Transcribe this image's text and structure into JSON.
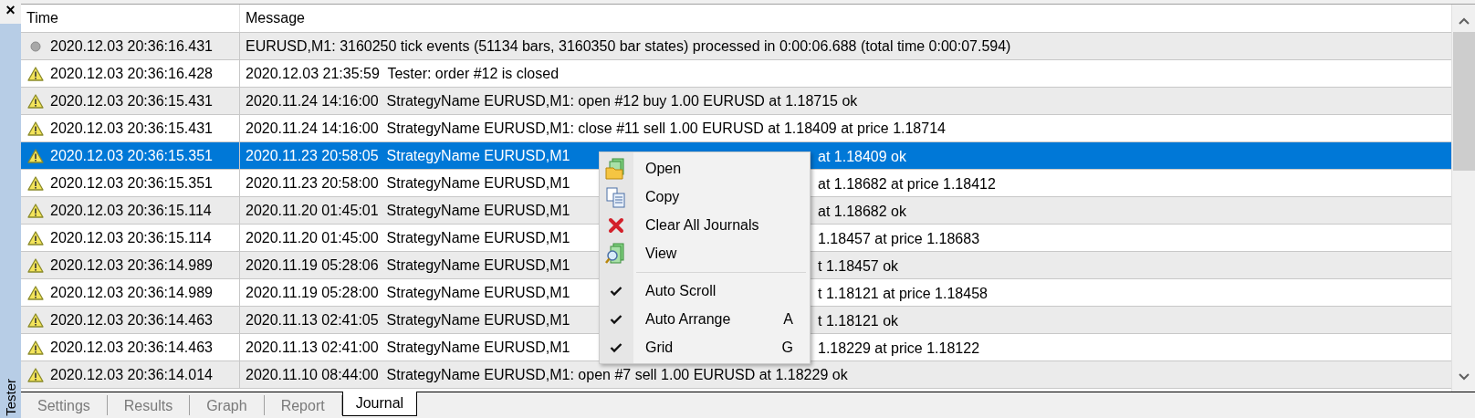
{
  "panel": {
    "close": "×",
    "title": "Tester"
  },
  "table": {
    "columns": [
      "Time",
      "Message"
    ],
    "rows": [
      {
        "kind": "info",
        "selected": false,
        "time": "2020.12.03 20:36:16.431",
        "message": "EURUSD,M1: 3160250 tick events (51134 bars, 3160350 bar states) processed in 0:00:06.688 (total time 0:00:07.594)"
      },
      {
        "kind": "warning",
        "selected": false,
        "time": "2020.12.03 20:36:16.428",
        "message": "2020.12.03 21:35:59  Tester: order #12 is closed"
      },
      {
        "kind": "warning",
        "selected": false,
        "time": "2020.12.03 20:36:15.431",
        "message": "2020.11.24 14:16:00  StrategyName EURUSD,M1: open #12 buy 1.00 EURUSD at 1.18715 ok"
      },
      {
        "kind": "warning",
        "selected": false,
        "time": "2020.12.03 20:36:15.431",
        "message": "2020.11.24 14:16:00  StrategyName EURUSD,M1: close #11 sell 1.00 EURUSD at 1.18409 at price 1.18714"
      },
      {
        "kind": "warning",
        "selected": true,
        "time": "2020.12.03 20:36:15.351",
        "message": "2020.11.23 20:58:05  StrategyName EURUSD,M1",
        "message_end": "at 1.18409 ok"
      },
      {
        "kind": "warning",
        "selected": false,
        "time": "2020.12.03 20:36:15.351",
        "message": "2020.11.23 20:58:00  StrategyName EURUSD,M1",
        "message_end": "at 1.18682 at price 1.18412"
      },
      {
        "kind": "warning",
        "selected": false,
        "time": "2020.12.03 20:36:15.114",
        "message": "2020.11.20 01:45:01  StrategyName EURUSD,M1",
        "message_end": "at 1.18682 ok"
      },
      {
        "kind": "warning",
        "selected": false,
        "time": "2020.12.03 20:36:15.114",
        "message": "2020.11.20 01:45:00  StrategyName EURUSD,M1",
        "message_end": "1.18457 at price 1.18683"
      },
      {
        "kind": "warning",
        "selected": false,
        "time": "2020.12.03 20:36:14.989",
        "message": "2020.11.19 05:28:06  StrategyName EURUSD,M1",
        "message_end": "t 1.18457 ok"
      },
      {
        "kind": "warning",
        "selected": false,
        "time": "2020.12.03 20:36:14.989",
        "message": "2020.11.19 05:28:00  StrategyName EURUSD,M1",
        "message_end": "t 1.18121 at price 1.18458"
      },
      {
        "kind": "warning",
        "selected": false,
        "time": "2020.12.03 20:36:14.463",
        "message": "2020.11.13 02:41:05  StrategyName EURUSD,M1",
        "message_end": "t 1.18121 ok"
      },
      {
        "kind": "warning",
        "selected": false,
        "time": "2020.12.03 20:36:14.463",
        "message": "2020.11.13 02:41:00  StrategyName EURUSD,M1",
        "message_end": "1.18229 at price 1.18122"
      },
      {
        "kind": "warning",
        "selected": false,
        "time": "2020.12.03 20:36:14.014",
        "message": "2020.11.10 08:44:00  StrategyName EURUSD,M1: open #7 sell 1.00 EURUSD at 1.18229 ok"
      }
    ]
  },
  "context_menu": {
    "groups": [
      [
        {
          "kind": "open",
          "label": "Open"
        },
        {
          "kind": "copy",
          "label": "Copy"
        },
        {
          "kind": "clear",
          "label": "Clear All Journals"
        },
        {
          "kind": "view",
          "label": "View"
        }
      ],
      [
        {
          "kind": "toggle",
          "label": "Auto Scroll",
          "checked": true
        },
        {
          "kind": "toggle",
          "label": "Auto Arrange",
          "checked": true,
          "shortcut": "A"
        },
        {
          "kind": "toggle",
          "label": "Grid",
          "checked": true,
          "shortcut": "G"
        }
      ]
    ]
  },
  "tabs": [
    {
      "label": "Settings",
      "selected": false
    },
    {
      "label": "Results",
      "selected": false
    },
    {
      "label": "Graph",
      "selected": false
    },
    {
      "label": "Report",
      "selected": false
    },
    {
      "label": "Journal",
      "selected": true
    }
  ]
}
